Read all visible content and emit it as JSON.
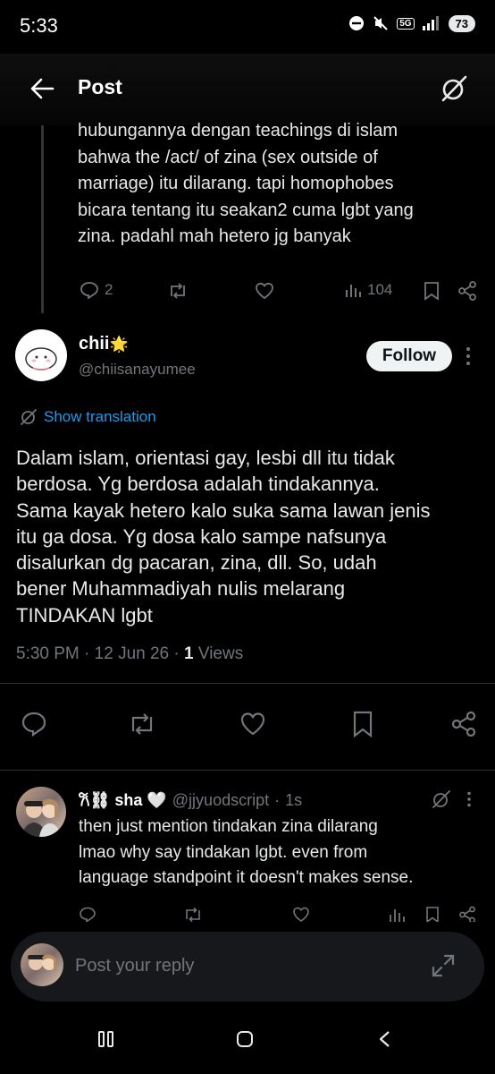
{
  "status_bar": {
    "time": "5:33",
    "network": "5G",
    "battery": "73"
  },
  "header": {
    "title": "Post"
  },
  "previous_post": {
    "text_lines": [
      "hubungannya dengan teachings di islam",
      "bahwa the /act/ of zina (sex outside of",
      "marriage) itu dilarang. tapi homophobes",
      "bicara tentang itu seakan2 cuma lgbt yang",
      "zina. padahl mah hetero jg banyak"
    ],
    "reply_count": "2",
    "view_count": "104"
  },
  "main_post": {
    "display_name": "chii",
    "name_emoji": "🌟",
    "handle": "@chiisanayumee",
    "follow_label": "Follow",
    "show_translation": "Show translation",
    "text_lines": [
      "Dalam islam, orientasi gay, lesbi dll itu tidak",
      "berdosa. Yg berdosa adalah tindakannya.",
      "Sama kayak hetero kalo suka sama lawan jenis",
      "itu ga dosa. Yg dosa kalo sampe nafsunya",
      "disalurkan dg pacaran, zina, dll. So, udah",
      "bener Muhammadiyah nulis melarang",
      "TINDAKAN lgbt"
    ],
    "meta_time": "5:30 PM",
    "meta_date": "12 Jun 26",
    "meta_views_count": "1",
    "meta_views_label": "Views"
  },
  "reply": {
    "display_name": "𐙚⛓ sha",
    "name_emoji": "🤍",
    "handle": "@jjyuodscript",
    "time": "1s",
    "text_lines": [
      "then just mention tindakan zina dilarang",
      "lmao why say tindakan lgbt. even from",
      "language standpoint it doesn't makes sense."
    ]
  },
  "compose": {
    "placeholder": "Post your reply"
  },
  "colors": {
    "accent": "#1d9bf0",
    "background": "#000000",
    "text": "#e7e9ea",
    "muted": "#71767b"
  }
}
